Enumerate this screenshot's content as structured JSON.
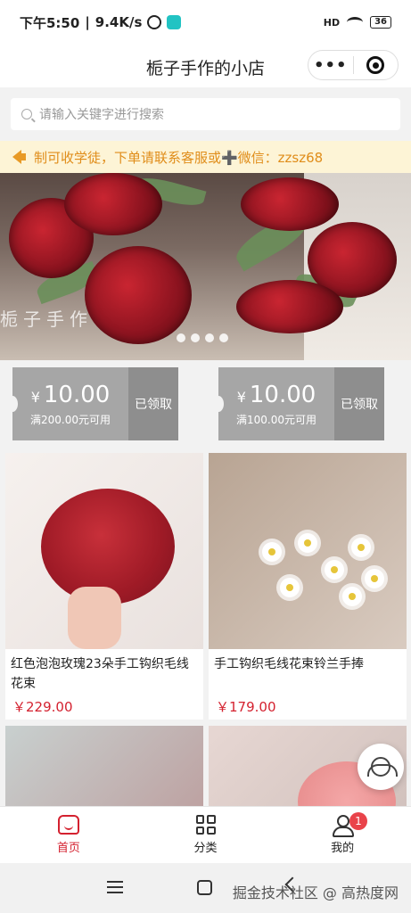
{
  "status_bar": {
    "time": "下午5:50",
    "speed": "9.4K/s",
    "signal": "HD",
    "battery": "36"
  },
  "header": {
    "title": "栀子手作的小店",
    "more_label": "•••"
  },
  "search": {
    "placeholder": "请输入关键字进行搜索"
  },
  "notice": {
    "text": "制可收学徒，下单请联系客服或➕微信：zzsz68"
  },
  "banner": {
    "watermark": "栀子手作",
    "slide_count": 4
  },
  "coupons": [
    {
      "currency": "¥",
      "amount": "10.00",
      "condition": "满200.00元可用",
      "action": "已领取"
    },
    {
      "currency": "¥",
      "amount": "10.00",
      "condition": "满100.00元可用",
      "action": "已领取"
    }
  ],
  "products": [
    {
      "name": "红色泡泡玫瑰23朵手工钩织毛线花束",
      "price": "￥229.00"
    },
    {
      "name": "手工钩织毛线花束铃兰手捧",
      "price": "￥179.00"
    }
  ],
  "tabbar": {
    "items": [
      {
        "label": "首页",
        "active": true
      },
      {
        "label": "分类",
        "active": false
      },
      {
        "label": "我的",
        "active": false,
        "badge": "1"
      }
    ]
  },
  "watermark_text": "掘金技术社区 @ 高热度网",
  "colors": {
    "accent": "#d4212f",
    "notice_bg": "#fdf4d6",
    "notice_text": "#e08d1a",
    "coupon_gray": "#a6a6a6"
  }
}
